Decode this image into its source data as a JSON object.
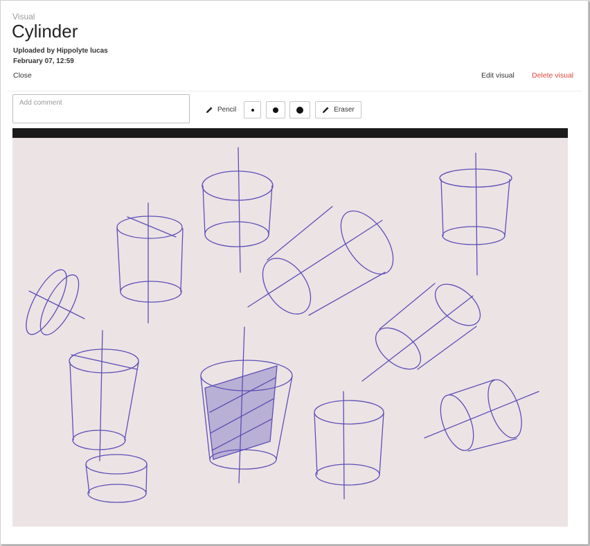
{
  "header": {
    "kicker": "Visual",
    "title": "Cylinder",
    "uploaded_by": "Uploaded by Hippolyte lucas",
    "date": "February 07, 12:59",
    "close_label": "Close",
    "edit_label": "Edit visual",
    "delete_label": "Delete visual",
    "delete_color": "#e0453a"
  },
  "comment": {
    "placeholder": "Add comment",
    "value": ""
  },
  "toolbar": {
    "pencil_label": "Pencil",
    "pencil_icon": "pencil-icon",
    "brush_sizes": [
      "small",
      "medium",
      "large"
    ],
    "eraser_label": "Eraser",
    "eraser_icon": "eraser-icon"
  },
  "image": {
    "subject": "pen sketches of cylinders on paper",
    "paper_color": "#ece3e5",
    "ink_color": "#5c4fb6"
  }
}
